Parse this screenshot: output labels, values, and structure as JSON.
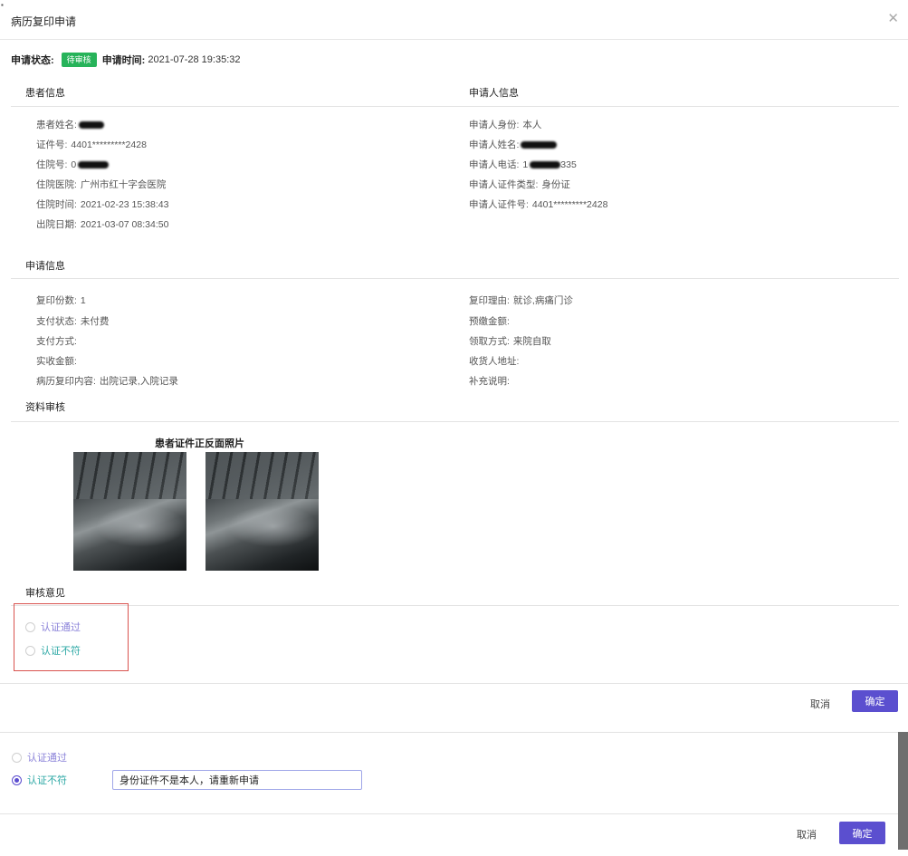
{
  "dialog": {
    "title": "病历复印申请",
    "close_icon": "close-icon"
  },
  "status": {
    "label": "申请状态:",
    "badge": "待审核",
    "badge_color": "#27b35a",
    "time_label": "申请时间:",
    "time_value": "2021-07-28 19:35:32"
  },
  "patient": {
    "section_title": "患者信息",
    "fields": [
      {
        "label": "患者姓名:",
        "value": ""
      },
      {
        "label": "证件号:",
        "value": "4401*********2428"
      },
      {
        "label": "住院号:",
        "value": "0"
      },
      {
        "label": "住院医院:",
        "value": "广州市红十字会医院"
      },
      {
        "label": "住院时间:",
        "value": "2021-02-23 15:38:43"
      },
      {
        "label": "出院日期:",
        "value": "2021-03-07 08:34:50"
      }
    ]
  },
  "applicant": {
    "section_title": "申请人信息",
    "fields": [
      {
        "label": "申请人身份:",
        "value": "本人"
      },
      {
        "label": "申请人姓名:",
        "value": ""
      },
      {
        "label": "申请人电话:",
        "value": "1",
        "suffix": "335"
      },
      {
        "label": "申请人证件类型:",
        "value": "身份证"
      },
      {
        "label": "申请人证件号:",
        "value": "4401*********2428"
      }
    ]
  },
  "application": {
    "section_title": "申请信息",
    "left_fields": [
      {
        "label": "复印份数:",
        "value": "1"
      },
      {
        "label": "支付状态:",
        "value": "未付费"
      },
      {
        "label": "支付方式:",
        "value": ""
      },
      {
        "label": "实收金额:",
        "value": ""
      },
      {
        "label": "病历复印内容:",
        "value": "出院记录,入院记录"
      }
    ],
    "right_fields": [
      {
        "label": "复印理由:",
        "value": "就诊,病痛门诊"
      },
      {
        "label": "预缴金额:",
        "value": ""
      },
      {
        "label": "领取方式:",
        "value": "来院自取"
      },
      {
        "label": "收货人地址:",
        "value": ""
      },
      {
        "label": "补充说明:",
        "value": ""
      }
    ]
  },
  "materials": {
    "section_title": "资料审核",
    "photos_title": "患者证件正反面照片"
  },
  "review": {
    "section_title": "审核意见",
    "option_pass": "认证通过",
    "option_fail": "认证不符",
    "cancel_label": "取消",
    "ok_label": "确定",
    "accent_color": "#5b4fcf"
  },
  "review_expanded": {
    "option_pass": "认证通过",
    "option_fail": "认证不符",
    "selected": "认证不符",
    "reason_value": "身份证件不是本人，请重新申请",
    "cancel_label": "取消",
    "ok_label": "确定"
  }
}
